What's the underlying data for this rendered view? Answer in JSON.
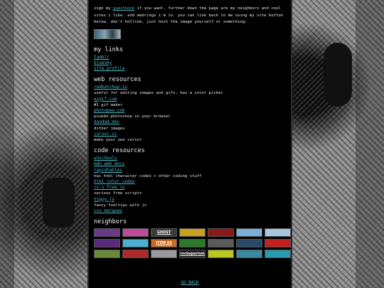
{
  "intro": {
    "text_before": "sign my ",
    "guestbook_link": "guestbook",
    "text_after": " if you want. further down the page are my neighbors and cool sites i like. and webrings i'm in. you can link back to me using my site button below. don't hotlink, just host the image yourself or something:"
  },
  "sections": {
    "my_links": {
      "heading": "my links",
      "items": [
        "tumblr",
        "bluesky",
        "site profile"
      ]
    },
    "web_resources": {
      "heading": "web resources",
      "items": [
        {
          "link": "redketchup.io",
          "desc": "useful for editing images and gifs, has a color picker"
        },
        {
          "link": "ezgif.com",
          "desc": "#1 gif maker"
        },
        {
          "link": "photopea.com",
          "desc": "psuedo-photoshop in your browser"
        },
        {
          "link": "doodad.dev",
          "desc": "dither images"
        },
        {
          "link": "cursor.cc",
          "desc": "make your own cursor"
        }
      ]
    },
    "code_resources": {
      "heading": "code resources",
      "items": [
        {
          "link": "w3schools",
          "desc": ""
        },
        {
          "link": "mdn web docs",
          "desc": ""
        },
        {
          "link": "rapidtables",
          "desc": "has html character codes + other coding stuff"
        },
        {
          "link": "html color codes",
          "desc": ""
        },
        {
          "link": "rv's free js",
          "desc": "various free scripts"
        },
        {
          "link": "tippy.js",
          "desc": "fancy tooltips with js"
        },
        {
          "link": "css marquee",
          "desc": ""
        }
      ]
    },
    "neighbors": {
      "heading": "neighbors",
      "buttons": [
        {
          "label": "",
          "color": "#6a3a8a"
        },
        {
          "label": "",
          "color": "#c04a9a"
        },
        {
          "label": "GHOST",
          "color": "#3a3a3a"
        },
        {
          "label": "",
          "color": "#c8a020"
        },
        {
          "label": "",
          "color": "#8a1a1a"
        },
        {
          "label": "",
          "color": "#7ab0d8"
        },
        {
          "label": "",
          "color": "#a8c8e0"
        },
        {
          "label": "",
          "color": "#5a2a7a"
        },
        {
          "label": "",
          "color": "#4ab0d0"
        },
        {
          "label": "ITEM 64",
          "color": "#c86a20"
        },
        {
          "label": "",
          "color": "#2a7a2a"
        },
        {
          "label": "",
          "color": "#5a5a5a"
        },
        {
          "label": "",
          "color": "#2a4a6a"
        },
        {
          "label": "",
          "color": "#c02020"
        },
        {
          "label": "",
          "color": "#6a8a3a"
        },
        {
          "label": "",
          "color": "#b02828"
        },
        {
          "label": "",
          "color": "#9a9a9a"
        },
        {
          "label": "rockeperism",
          "color": "#1a1a1a"
        },
        {
          "label": "",
          "color": "#b8c820"
        },
        {
          "label": "",
          "color": "#3a8aa0"
        },
        {
          "label": "",
          "color": "#2a9ab0"
        }
      ]
    }
  },
  "go_back": "GO BACK"
}
